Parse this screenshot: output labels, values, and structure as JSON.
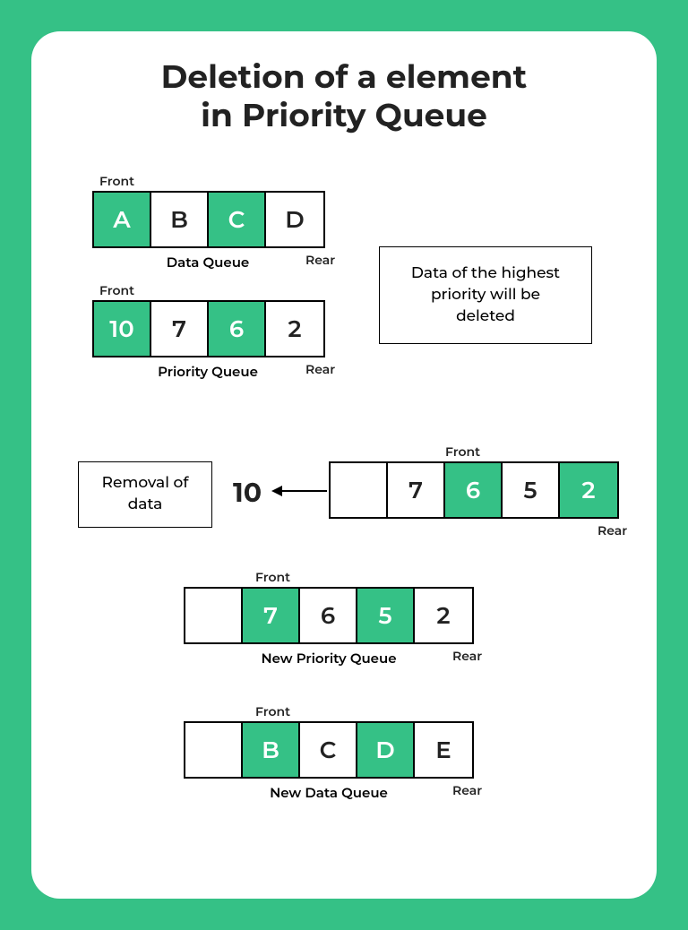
{
  "title_line1": "Deletion of a element",
  "title_line2": "in Priority Queue",
  "labels": {
    "front": "Front",
    "rear": "Rear",
    "data_queue": "Data Queue",
    "priority_queue": "Priority Queue",
    "new_priority_queue": "New Priority Queue",
    "new_data_queue": "New Data Queue",
    "removal": "Removal of data"
  },
  "info_box": "Data of the highest priority will be deleted",
  "data_queue": [
    "A",
    "B",
    "C",
    "D"
  ],
  "priority_queue": [
    "10",
    "7",
    "6",
    "2"
  ],
  "removed_value": "10",
  "mid_queue": [
    "",
    "7",
    "6",
    "5",
    "2"
  ],
  "new_priority_queue": [
    "",
    "7",
    "6",
    "5",
    "2"
  ],
  "new_data_queue": [
    "",
    "B",
    "C",
    "D",
    "E"
  ]
}
